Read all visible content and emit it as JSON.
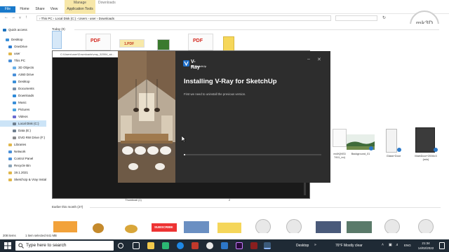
{
  "ribbon": {
    "tabs": [
      "File",
      "Home",
      "Share",
      "View",
      "Application Tools"
    ],
    "manage": "Manage",
    "window_title": "Downloads"
  },
  "address": {
    "path": "›  This PC  ›  Local Disk (C:)  ›  Users  ›  user  ›  Downloads"
  },
  "nav": [
    {
      "label": "Quick access",
      "color": "#1e73be"
    },
    {
      "label": "Desktop",
      "color": "#3a8fd8"
    },
    {
      "label": "OneDrive",
      "color": "#2b7cd3"
    },
    {
      "label": "user",
      "color": "#e0b64a"
    },
    {
      "label": "This PC",
      "color": "#4a90d9"
    },
    {
      "label": "3D Objects",
      "color": "#6ab0e8"
    },
    {
      "label": "A360 Drive",
      "color": "#4a90d9"
    },
    {
      "label": "Desktop",
      "color": "#3a8fd8"
    },
    {
      "label": "Documents",
      "color": "#7a8fa6"
    },
    {
      "label": "Downloads",
      "color": "#2d8ad8"
    },
    {
      "label": "Music",
      "color": "#3a8fd8"
    },
    {
      "label": "Pictures",
      "color": "#4aa3df"
    },
    {
      "label": "Videos",
      "color": "#6a6ad0"
    },
    {
      "label": "Local Disk (C:)",
      "color": "#6f7f8f"
    },
    {
      "label": "Data (E:)",
      "color": "#6f7f8f"
    },
    {
      "label": "DVD RW Drive (F:)",
      "color": "#8a8a8a"
    },
    {
      "label": "Libraries",
      "color": "#e0b64a"
    },
    {
      "label": "Network",
      "color": "#4a90d9"
    },
    {
      "label": "Control Panel",
      "color": "#4a90d9"
    },
    {
      "label": "Recycle Bin",
      "color": "#8aa4b8"
    },
    {
      "label": "19.1.2021",
      "color": "#e0b64a"
    },
    {
      "label": "SketchUp & Vray Install",
      "color": "#e0b64a"
    }
  ],
  "groups": {
    "today": "Today (9)",
    "earlier": "Earlier this month (27)"
  },
  "files": {
    "f1": "ex4K(NS3\n7411_no)",
    "f2": "Background_01",
    "f3": "Glass+Door",
    "f4": "MainDoor+2004x3\n(min)",
    "f5": "Thumbnail (1)",
    "f6": "2"
  },
  "thumb_badges": {
    "pdf": "PDF",
    "pdf_icon": "1.PDF",
    "subscribe": "SUBSCRIBE"
  },
  "cmd": {
    "path": "C:\\Users\\user\\Downloads\\vray_52004_sk..."
  },
  "installer": {
    "logo": "V-Ray",
    "logo_sub": "for SketchUp",
    "title": "Installing V-Ray for SketchUp",
    "message": "First we need to uninstall the previous version.",
    "progress": 0.01
  },
  "status": {
    "items": "208 items",
    "selected": "1 item selected  641 MB"
  },
  "taskbar": {
    "search_placeholder": "Type here to search",
    "desktop": "Desktop",
    "weather": "76°F  Mostly clear",
    "lang": "ENG",
    "time": "21:34",
    "date": "14/02/2022"
  },
  "watermark": {
    "text": "mk3D",
    "sub": "Visualization"
  }
}
